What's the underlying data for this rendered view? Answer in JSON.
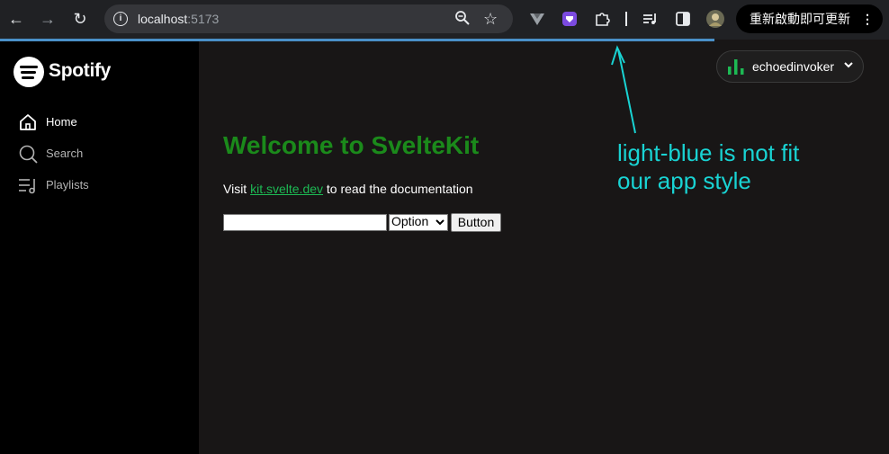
{
  "browser": {
    "url_host": "localhost",
    "url_port": ":5173",
    "update_button_label": "重新啟動即可更新",
    "icons": [
      "back-icon",
      "forward-icon",
      "reload-icon",
      "site-info-icon",
      "zoom-icon",
      "bookmark-star-icon",
      "vue-devtools-icon",
      "extension-purple-icon",
      "extensions-puzzle-icon",
      "media-control-icon",
      "side-panel-icon",
      "profile-avatar-icon",
      "menu-dots-icon"
    ]
  },
  "sidebar": {
    "brand": "Spotify",
    "items": [
      {
        "label": "Home",
        "icon": "home-icon",
        "active": true
      },
      {
        "label": "Search",
        "icon": "search-icon"
      },
      {
        "label": "Playlists",
        "icon": "playlists-icon"
      }
    ]
  },
  "header": {
    "username": "echoedinvoker",
    "user_icon": "equalizer-bars-icon"
  },
  "main": {
    "title": "Welcome to SvelteKit",
    "text_before_link": "Visit ",
    "link_text": "kit.svelte.dev",
    "text_after_link": " to read the documentation",
    "input_value": "",
    "select_value": "Option",
    "button_label": "Button"
  },
  "annotation": {
    "line1": "light-blue is not fit",
    "line2": "our app style"
  },
  "colors": {
    "accent_green": "#1db954",
    "heading_green": "#1b8a1b",
    "progress_blue": "#4a90c8",
    "annotation_cyan": "#19d3d3"
  }
}
